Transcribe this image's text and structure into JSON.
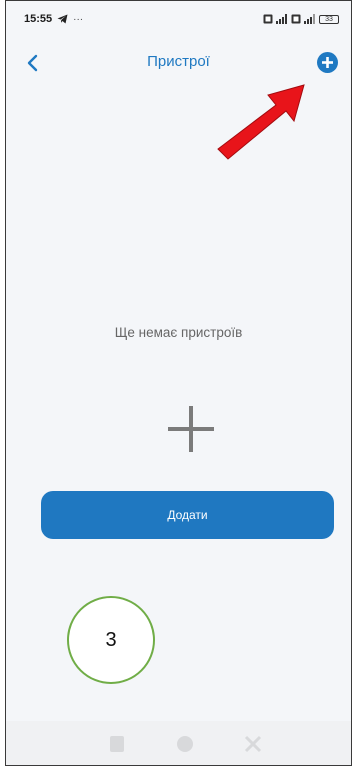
{
  "status_bar": {
    "time": "15:55",
    "extra": "···",
    "battery": "33"
  },
  "header": {
    "title": "Пристрої"
  },
  "empty_state": {
    "message": "Ще немає пристроїв"
  },
  "add_button": {
    "label": "Додати"
  },
  "annotation": {
    "step_number": "3"
  },
  "colors": {
    "accent": "#1f79c2",
    "arrow": "#e8141a",
    "badge_border": "#70ad47"
  },
  "icons": {
    "back": "chevron-left-icon",
    "add": "plus-circle-icon",
    "empty": "plus-icon"
  }
}
